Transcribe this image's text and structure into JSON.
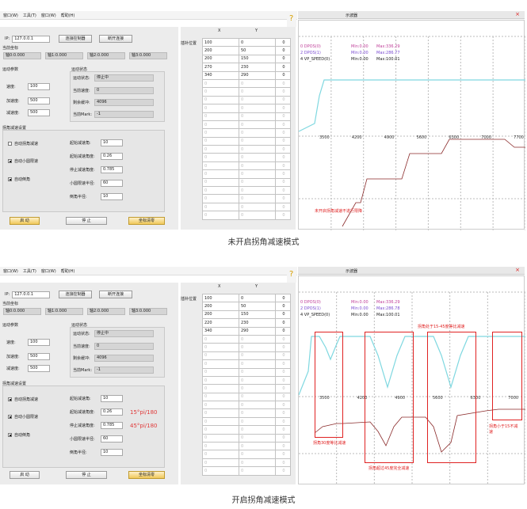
{
  "menu": [
    "窗口(W)",
    "工具(T)",
    "窗口(W)",
    "帮助(H)"
  ],
  "screens": [
    {
      "ip_label": "IP:",
      "ip": "127.0.0.1",
      "connect": "连接控制器",
      "disconnect": "断开连接",
      "coord_title": "当前坐标",
      "axes": [
        "轴0:0.000",
        "轴1:0.000",
        "轴2:0.000",
        "轴3:0.000"
      ],
      "motion_title": "运动参数",
      "status_title": "运动状态",
      "speed_label": "速度:",
      "speed": "100",
      "accel_label": "加速度:",
      "accel": "500",
      "decel_label": "减速度:",
      "decel": "500",
      "status_label": "运动状态:",
      "status": "停止中",
      "cur_speed_label": "当前速度:",
      "cur_speed": "0",
      "buffer_label": "剩余缓冲:",
      "buffer": "4096",
      "mark_label": "当前Mark:",
      "mark": "-1",
      "corner_title": "拐角减速设置",
      "opt1": "自动拐角减速",
      "opt2": "自动小圆限速",
      "opt3": "自动倒角",
      "p1_label": "起始减速角:",
      "p1": "10",
      "p2_label": "起始减速角度:",
      "p2": "0.26",
      "p3_label": "停止减速角度:",
      "p3": "0.785",
      "p4_label": "小圆限速半径:",
      "p4": "60",
      "p5_label": "倒角半径:",
      "p5": "10",
      "start": "启 动",
      "stop": "停 止",
      "zero": "坐标清零",
      "pos_label": "插补位置",
      "col_x": "X",
      "col_y": "Y",
      "rows": [
        [
          "100",
          "0",
          "0"
        ],
        [
          "200",
          "50",
          "0"
        ],
        [
          "200",
          "150",
          "0"
        ],
        [
          "270",
          "230",
          "0"
        ],
        [
          "340",
          "290",
          "0"
        ]
      ],
      "empty": "0",
      "scope_title": "示波器",
      "legend": [
        {
          "name": "0 DPOS(0)",
          "min": "Min:0.00",
          "max": "Max:336.29"
        },
        {
          "name": "2 DPOS(1)",
          "min": "Min:0.00",
          "max": "Max:286.77"
        },
        {
          "name": "4 VP_SPEED(0)",
          "min": "Min:0.00",
          "max": "Max:100.01"
        }
      ],
      "ticks": [
        "3500",
        "4200",
        "4900",
        "5600",
        "6300",
        "7000",
        "7700"
      ],
      "note": "未开启拐角减速不进行限降",
      "caption": "未开启拐角减速模式"
    },
    {
      "p2_unit": "15°pi/180",
      "p3_unit": "45°pi/180",
      "rows": [
        [
          "100",
          "0",
          "0"
        ],
        [
          "200",
          "50",
          "0"
        ],
        [
          "200",
          "150",
          "0"
        ],
        [
          "220",
          "230",
          "0"
        ],
        [
          "340",
          "290",
          "0"
        ]
      ],
      "legend": [
        {
          "name": "0 DPOS(0)",
          "min": "Min:0.00",
          "max": "Max:336.29"
        },
        {
          "name": "2 DPOS(1)",
          "min": "Min:0.00",
          "max": "Max:286.78"
        },
        {
          "name": "4 VP_SPEED(0)",
          "min": "Min:0.00",
          "max": "Max:100.01"
        }
      ],
      "ticks": [
        "3500",
        "4200",
        "4900",
        "5600",
        "6300",
        "7000"
      ],
      "note_top": "拐角处于15-45度等比减速",
      "note_a": "拐角30度等比减速",
      "note_b": "拐角超过45度完全减速",
      "note_c": "拐角小于15不减速",
      "caption": "开启拐角减速模式"
    }
  ],
  "colors": {
    "accent": "#e02222",
    "speed_trace": "#7fd8e0",
    "pos_trace": "#8a2a2a"
  }
}
